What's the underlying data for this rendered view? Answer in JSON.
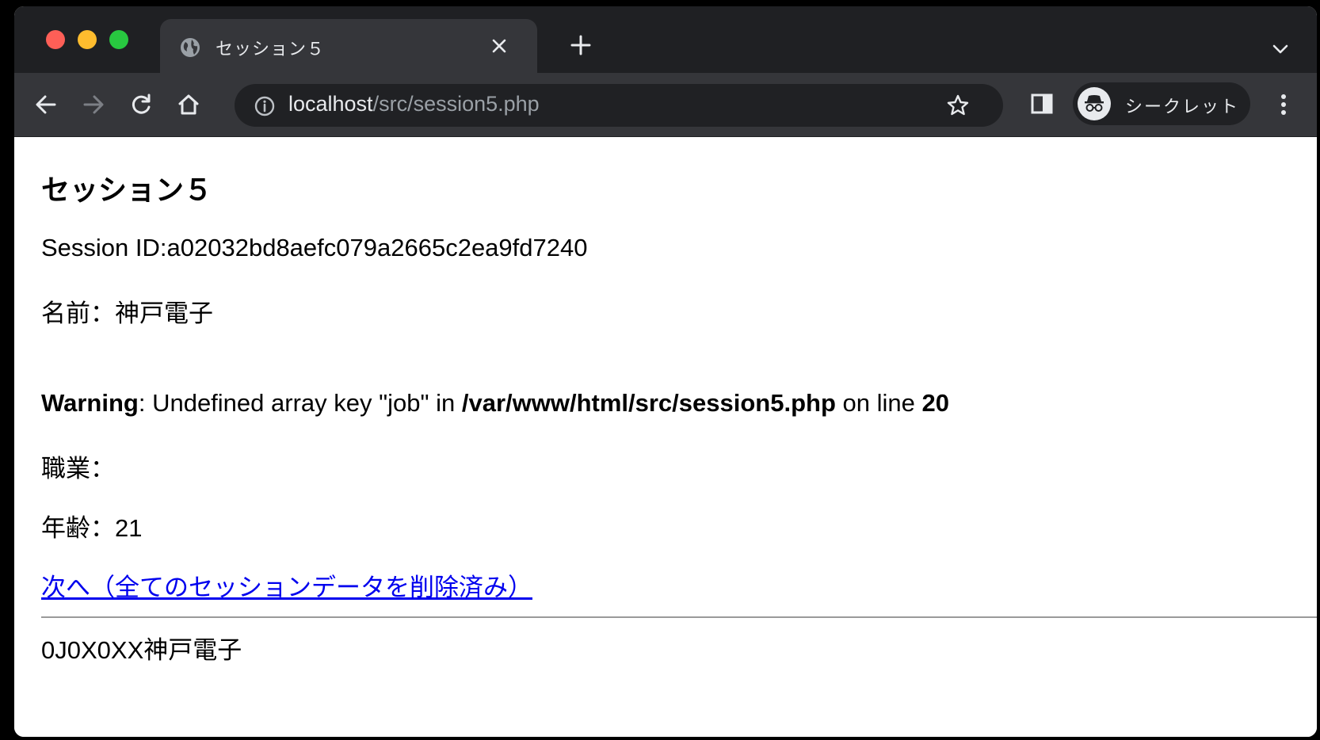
{
  "browser": {
    "tab_title": "セッション５",
    "url_host": "localhost",
    "url_path": "/src/session5.php",
    "incognito_label": "シークレット"
  },
  "page": {
    "heading": "セッション５",
    "session_id": "Session ID:a02032bd8aefc079a2665c2ea9fd7240",
    "name_line": "名前：神戸電子",
    "warning": {
      "label": "Warning",
      "message": ": Undefined array key \"job\" in ",
      "file": "/var/www/html/src/session5.php",
      "on_line": " on line ",
      "line": "20"
    },
    "job_line": "職業：",
    "age_line": "年齢：21",
    "next_link": "次へ（全てのセッションデータを削除済み）",
    "footer_text": "0J0X0XX神戸電子"
  }
}
